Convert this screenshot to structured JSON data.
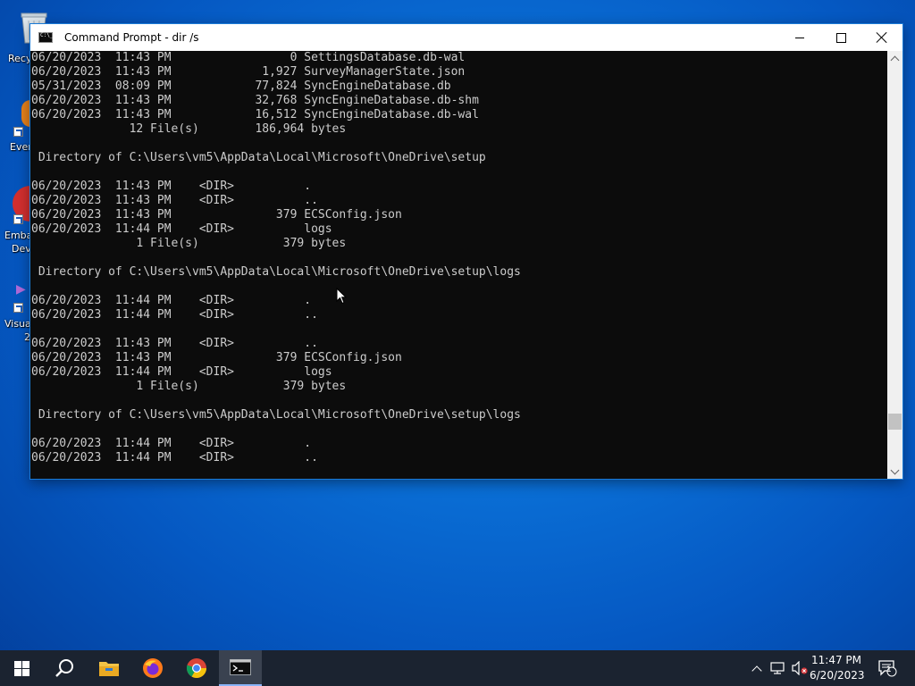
{
  "desktop": {
    "icons": [
      {
        "label": "Recy",
        "name": "recycle-bin-icon"
      },
      {
        "label": "Ever",
        "name": "everything-icon"
      },
      {
        "label": "Emba",
        "label2": "Dev",
        "name": "embarcadero-dev-icon"
      },
      {
        "label": "Visua",
        "label2": "2",
        "name": "visual-studio-icon"
      }
    ]
  },
  "window": {
    "title": "Command Prompt - dir /s",
    "minimize": "minimize",
    "maximize": "maximize",
    "close": "close"
  },
  "console": {
    "lines": [
      "06/20/2023  11:43 PM                 0 SettingsDatabase.db-wal",
      "06/20/2023  11:43 PM             1,927 SurveyManagerState.json",
      "05/31/2023  08:09 PM            77,824 SyncEngineDatabase.db",
      "06/20/2023  11:43 PM            32,768 SyncEngineDatabase.db-shm",
      "06/20/2023  11:43 PM            16,512 SyncEngineDatabase.db-wal",
      "              12 File(s)        186,964 bytes",
      "",
      " Directory of C:\\Users\\vm5\\AppData\\Local\\Microsoft\\OneDrive\\setup",
      "",
      "06/20/2023  11:43 PM    <DIR>          .",
      "06/20/2023  11:43 PM    <DIR>          ..",
      "06/20/2023  11:43 PM               379 ECSConfig.json",
      "06/20/2023  11:44 PM    <DIR>          logs",
      "               1 File(s)            379 bytes",
      "",
      " Directory of C:\\Users\\vm5\\AppData\\Local\\Microsoft\\OneDrive\\setup\\logs",
      "",
      "06/20/2023  11:44 PM    <DIR>          .",
      "06/20/2023  11:44 PM    <DIR>          ..",
      "",
      "06/20/2023  11:43 PM    <DIR>          ..",
      "06/20/2023  11:43 PM               379 ECSConfig.json",
      "06/20/2023  11:44 PM    <DIR>          logs",
      "               1 File(s)            379 bytes",
      "",
      " Directory of C:\\Users\\vm5\\AppData\\Local\\Microsoft\\OneDrive\\setup\\logs",
      "",
      "06/20/2023  11:44 PM    <DIR>          .",
      "06/20/2023  11:44 PM    <DIR>          .."
    ],
    "colors": {
      "background": "#0c0c0c",
      "text": "#cccccc"
    }
  },
  "taskbar": {
    "items": [
      "start-icon",
      "search-icon",
      "file-explorer-icon",
      "firefox-icon",
      "chrome-icon",
      "command-prompt-icon"
    ],
    "tray": [
      "show-hidden-icons",
      "network-icon",
      "volume-icon"
    ],
    "time": "11:47 PM",
    "date": "6/20/2023",
    "notification_count": "1",
    "colors": {
      "background": "#1b2330",
      "accent": "#8ab4f8"
    }
  }
}
